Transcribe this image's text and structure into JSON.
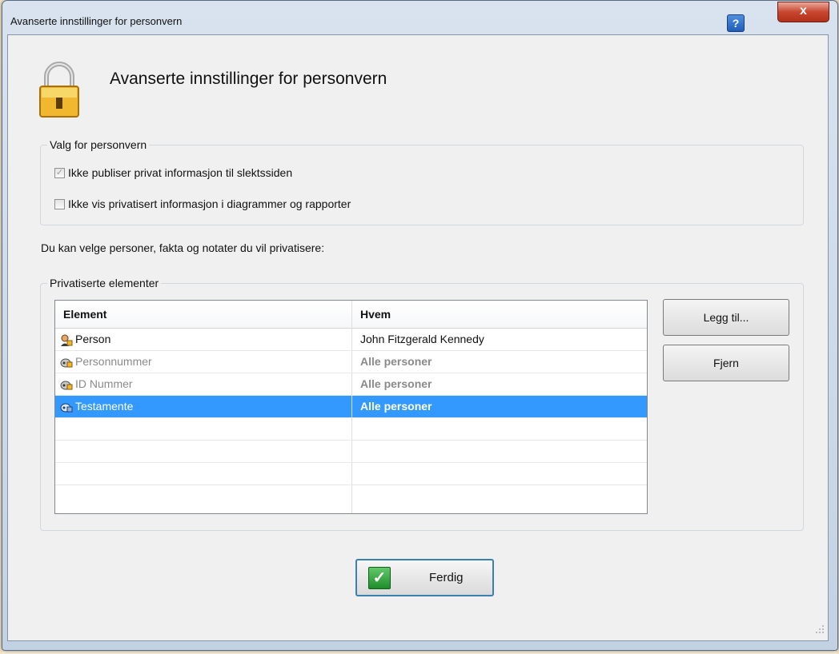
{
  "window": {
    "title": "Avanserte innstillinger for personvern",
    "help_icon": "?",
    "close_icon": "x"
  },
  "header": {
    "icon": "padlock-icon",
    "title": "Avanserte innstillinger for personvern"
  },
  "privacy_options": {
    "legend": "Valg for personvern",
    "options": [
      {
        "label": "Ikke publiser privat informasjon til slektssiden",
        "checked": true,
        "disabled": true
      },
      {
        "label": "Ikke vis privatisert informasjon i diagrammer og rapporter",
        "checked": false,
        "disabled": false
      }
    ]
  },
  "intro_text": "Du kan velge personer, fakta og notater du vil privatisere:",
  "private_items": {
    "legend": "Privatiserte elementer",
    "columns": [
      "Element",
      "Hvem"
    ],
    "rows": [
      {
        "element": "Person",
        "who": "John Fitzgerald Kennedy",
        "icon": "person-lock-icon",
        "state": "normal"
      },
      {
        "element": "Personnummer",
        "who": "Alle personer",
        "icon": "fact-lock-icon",
        "state": "dim"
      },
      {
        "element": "ID Nummer",
        "who": "Alle personer",
        "icon": "fact-lock-icon",
        "state": "dim"
      },
      {
        "element": "Testamente",
        "who": "Alle personer",
        "icon": "fact-lock-icon",
        "state": "selected"
      }
    ],
    "add_button": "Legg til...",
    "remove_button": "Fjern"
  },
  "done_button": {
    "label": "Ferdig",
    "icon": "green-check-icon",
    "check_glyph": "✓"
  },
  "colors": {
    "selection": "#3399ff",
    "focus_border": "#3c7fb1"
  }
}
